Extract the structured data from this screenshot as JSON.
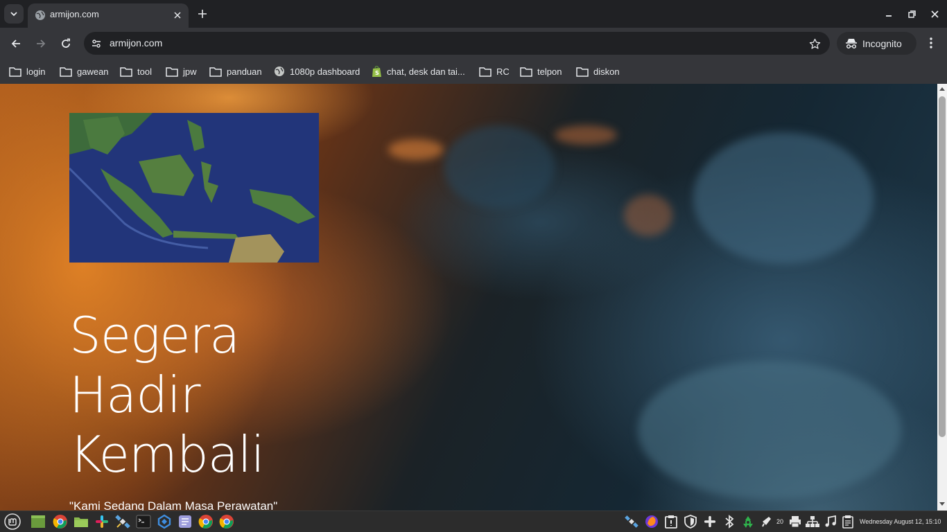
{
  "browser": {
    "tab": {
      "title": "armijon.com"
    },
    "address_bar": {
      "url": "armijon.com"
    },
    "incognito_label": "Incognito"
  },
  "bookmarks": [
    {
      "label": "login",
      "icon": "folder-icon"
    },
    {
      "label": "gawean",
      "icon": "folder-icon"
    },
    {
      "label": "tool",
      "icon": "folder-icon"
    },
    {
      "label": "jpw",
      "icon": "folder-icon"
    },
    {
      "label": "panduan",
      "icon": "folder-icon"
    },
    {
      "label": "1080p dashboard",
      "icon": "globe-icon"
    },
    {
      "label": "chat, desk dan tai...",
      "icon": "shopify-icon"
    },
    {
      "label": "RC",
      "icon": "folder-icon"
    },
    {
      "label": "telpon",
      "icon": "folder-icon"
    },
    {
      "label": "diskon",
      "icon": "folder-icon"
    }
  ],
  "page": {
    "headline": [
      "Segera",
      "Hadir",
      "Kembali"
    ],
    "subline": "\"Kami Sedang Dalam Masa Perawatan\"",
    "image": "map-of-indonesia-satellite"
  },
  "taskbar": {
    "notification_count": "20",
    "clock": "Wednesday August 12, 15:10",
    "apps": [
      "mint-menu-icon",
      "show-desktop-icon",
      "chrome-icon",
      "files-icon",
      "slack-icon",
      "satellite-icon",
      "terminal-icon",
      "update-icon",
      "text-editor-icon",
      "chrome-icon",
      "chrome-icon"
    ],
    "tray": [
      "satellite-icon",
      "firefox-dev-icon",
      "clipboard-icon",
      "shield-icon",
      "slack-icon",
      "bluetooth-icon",
      "recycle-icon",
      "notifications-icon",
      "printer-icon",
      "network-icon",
      "music-icon",
      "clipboard-manager-icon"
    ]
  },
  "colors": {
    "tab_bg": "#35363a",
    "window_bg": "#202124",
    "text": "#e8eaed",
    "taskbar_bg": "#2c2c2c"
  }
}
